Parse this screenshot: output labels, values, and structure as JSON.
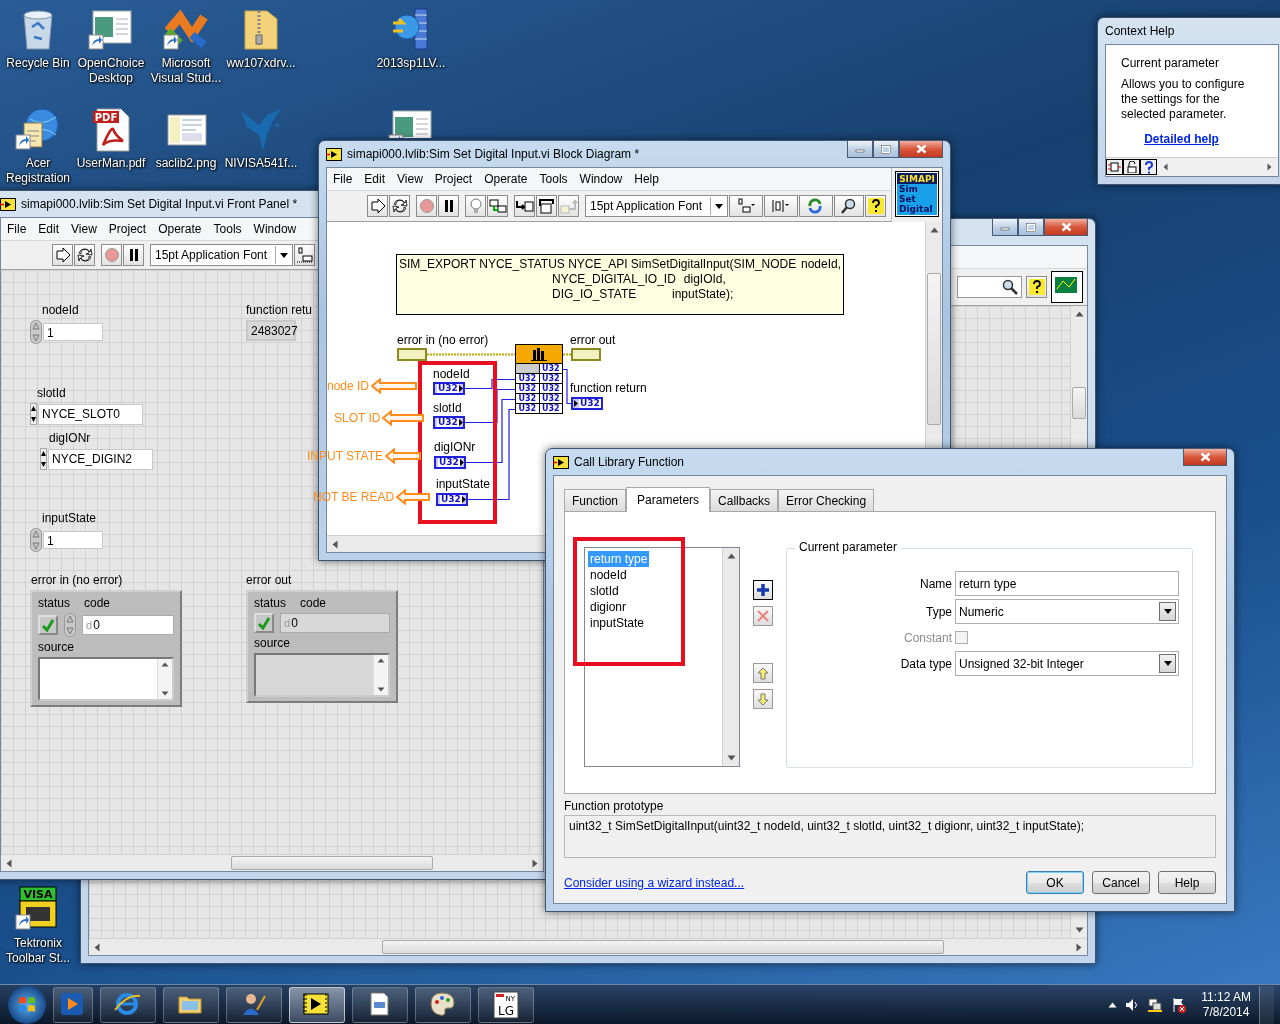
{
  "desktop_icons": [
    {
      "kind": "recycle",
      "label": "Recycle Bin"
    },
    {
      "kind": "app",
      "label": "OpenChoice Desktop"
    },
    {
      "kind": "ribbon",
      "label": "Microsoft Visual Stud..."
    },
    {
      "kind": "zip",
      "label": "ww107xdrv..."
    },
    {
      "kind": "installer",
      "label": "2013sp1LV..."
    },
    {
      "kind": "acer",
      "label": "Acer Registration"
    },
    {
      "kind": "pdf",
      "label": "UserMan.pdf",
      "badge": "PDF"
    },
    {
      "kind": "image",
      "label": "saclib2.png"
    },
    {
      "kind": "bird",
      "label": "NIVISA541f..."
    },
    {
      "kind": "app"
    },
    {
      "kind": "visa",
      "label": "Tektronix Toolbar St...",
      "badge": "VISA"
    }
  ],
  "front_panel": {
    "title": "simapi000.lvlib:Sim Set Digital Input.vi Front Panel *",
    "menu": [
      "File",
      "Edit",
      "View",
      "Project",
      "Operate",
      "Tools",
      "Window"
    ],
    "font": "15pt Application Font",
    "controls": [
      {
        "kind": "numeric",
        "label": "nodeId",
        "value": "1"
      },
      {
        "kind": "indicator",
        "label": "function retu",
        "value": "2483027"
      },
      {
        "kind": "ring",
        "label": "slotId",
        "value": "NYCE_SLOT0"
      },
      {
        "kind": "ring",
        "label": "digIONr",
        "value": "NYCE_DIGIN2"
      },
      {
        "kind": "numeric",
        "label": "inputState",
        "value": "1"
      },
      {
        "kind": "error_control",
        "label": "error in (no error)",
        "status_label": "status",
        "status": true,
        "code_label": "code",
        "radix": "d",
        "code": "0",
        "source_label": "source"
      },
      {
        "kind": "error_indicator",
        "label": "error out",
        "status_label": "status",
        "status": true,
        "code_label": "code",
        "radix": "d",
        "code": "0",
        "source_label": "source"
      }
    ]
  },
  "block_diagram": {
    "title": "simapi000.lvlib:Sim Set Digital Input.vi Block Diagram *",
    "menu": [
      "File",
      "Edit",
      "View",
      "Project",
      "Operate",
      "Tools",
      "Window",
      "Help"
    ],
    "font": "15pt Application Font",
    "vi_icon": [
      "SIMAPI",
      "Sim",
      "Set",
      "Digital"
    ],
    "comment": [
      {
        "type": "SIM_EXPORT NYCE_STATUS NYCE_API SimSetDigitalInput(SIM_NODE",
        "param": "nodeId,"
      },
      {
        "type": "NYCE_DIGITAL_IO_ID",
        "param": "digIOId,"
      },
      {
        "type": "DIG_IO_STATE",
        "param": "inputState);"
      }
    ],
    "error_in": "error in (no error)",
    "error_out": "error out",
    "terminals": [
      {
        "label": "nodeId",
        "type": "U32",
        "annotation": "node ID"
      },
      {
        "label": "slotId",
        "type": "U32",
        "annotation": "SLOT ID"
      },
      {
        "label": "digIONr",
        "type": "U32",
        "annotation": "INPUT STATE"
      },
      {
        "label": "inputState",
        "type": "U32",
        "annotation": "NOT BE READ"
      }
    ],
    "function_return": {
      "label": "function return",
      "type": "U32"
    },
    "node_ports": [
      "U32",
      "U32",
      "U32",
      "U32",
      "U32",
      "U32",
      "U32",
      "U32",
      "U32"
    ]
  },
  "dialog": {
    "title": "Call Library Function",
    "tabs": [
      {
        "label": "Function",
        "selected": false
      },
      {
        "label": "Parameters",
        "selected": true
      },
      {
        "label": "Callbacks",
        "selected": false
      },
      {
        "label": "Error Checking",
        "selected": false
      }
    ],
    "parameters": [
      {
        "label": "return type",
        "selected": true
      },
      {
        "label": "nodeId",
        "selected": false
      },
      {
        "label": "slotId",
        "selected": false
      },
      {
        "label": "digionr",
        "selected": false
      },
      {
        "label": "inputState",
        "selected": false
      }
    ],
    "group_title": "Current parameter",
    "fields": [
      {
        "kind": "text",
        "label": "Name",
        "value": "return type"
      },
      {
        "kind": "select",
        "label": "Type",
        "value": "Numeric"
      },
      {
        "kind": "checkbox",
        "label": "Constant",
        "checked": false,
        "disabled": true
      },
      {
        "kind": "select",
        "label": "Data type",
        "value": "Unsigned 32-bit Integer"
      }
    ],
    "prototype_label": "Function prototype",
    "prototype": "uint32_t SimSetDigitalInput(uint32_t nodeId, uint32_t slotId, uint32_t digionr, uint32_t inputState);",
    "wizard_link": "Consider using a wizard instead...",
    "buttons": [
      {
        "label": "OK",
        "default": true
      },
      {
        "label": "Cancel",
        "default": false
      },
      {
        "label": "Help",
        "default": false
      }
    ]
  },
  "context_help": {
    "title": "Context Help",
    "heading": "Current parameter",
    "body": "Allows you to configure the settings for the selected parameter.",
    "link": "Detailed help"
  },
  "taskbar": {
    "buttons": [
      {
        "kind": "media",
        "active": false
      },
      {
        "kind": "browser",
        "active": false
      },
      {
        "kind": "folder",
        "active": false
      },
      {
        "kind": "wizard",
        "active": false
      },
      {
        "kind": "labview",
        "active": true
      },
      {
        "kind": "document",
        "active": false
      },
      {
        "kind": "paint",
        "active": false
      },
      {
        "kind": "lg",
        "active": false,
        "text": [
          "NY",
          "LG"
        ]
      }
    ],
    "clock": {
      "time": "11:12 AM",
      "date": "7/8/2014"
    }
  }
}
